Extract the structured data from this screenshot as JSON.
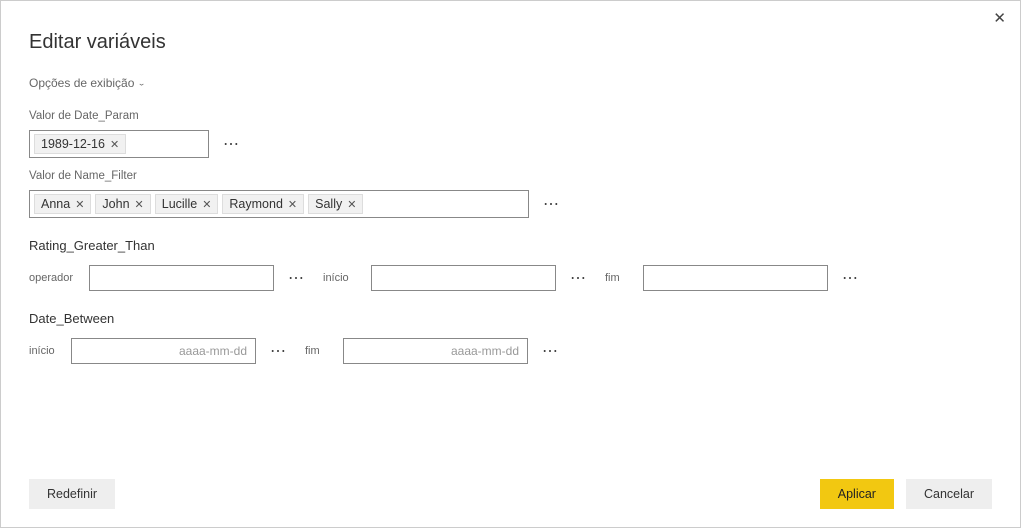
{
  "dialog": {
    "title": "Editar variáveis",
    "displayOptions": "Opções de exibição"
  },
  "dateParam": {
    "label": "Valor de Date_Param",
    "value": "1989-12-16"
  },
  "nameFilter": {
    "label": "Valor de Name_Filter",
    "tokens": [
      "Anna",
      "John",
      "Lucille",
      "Raymond",
      "Sally"
    ]
  },
  "ratingGreater": {
    "label": "Rating_Greater_Than",
    "operatorLabel": "operador",
    "startLabel": "início",
    "endLabel": "fim"
  },
  "dateBetween": {
    "label": "Date_Between",
    "startLabel": "início",
    "endLabel": "fim",
    "placeholder": "aaaa-mm-dd"
  },
  "footer": {
    "reset": "Redefinir",
    "apply": "Aplicar",
    "cancel": "Cancelar"
  }
}
